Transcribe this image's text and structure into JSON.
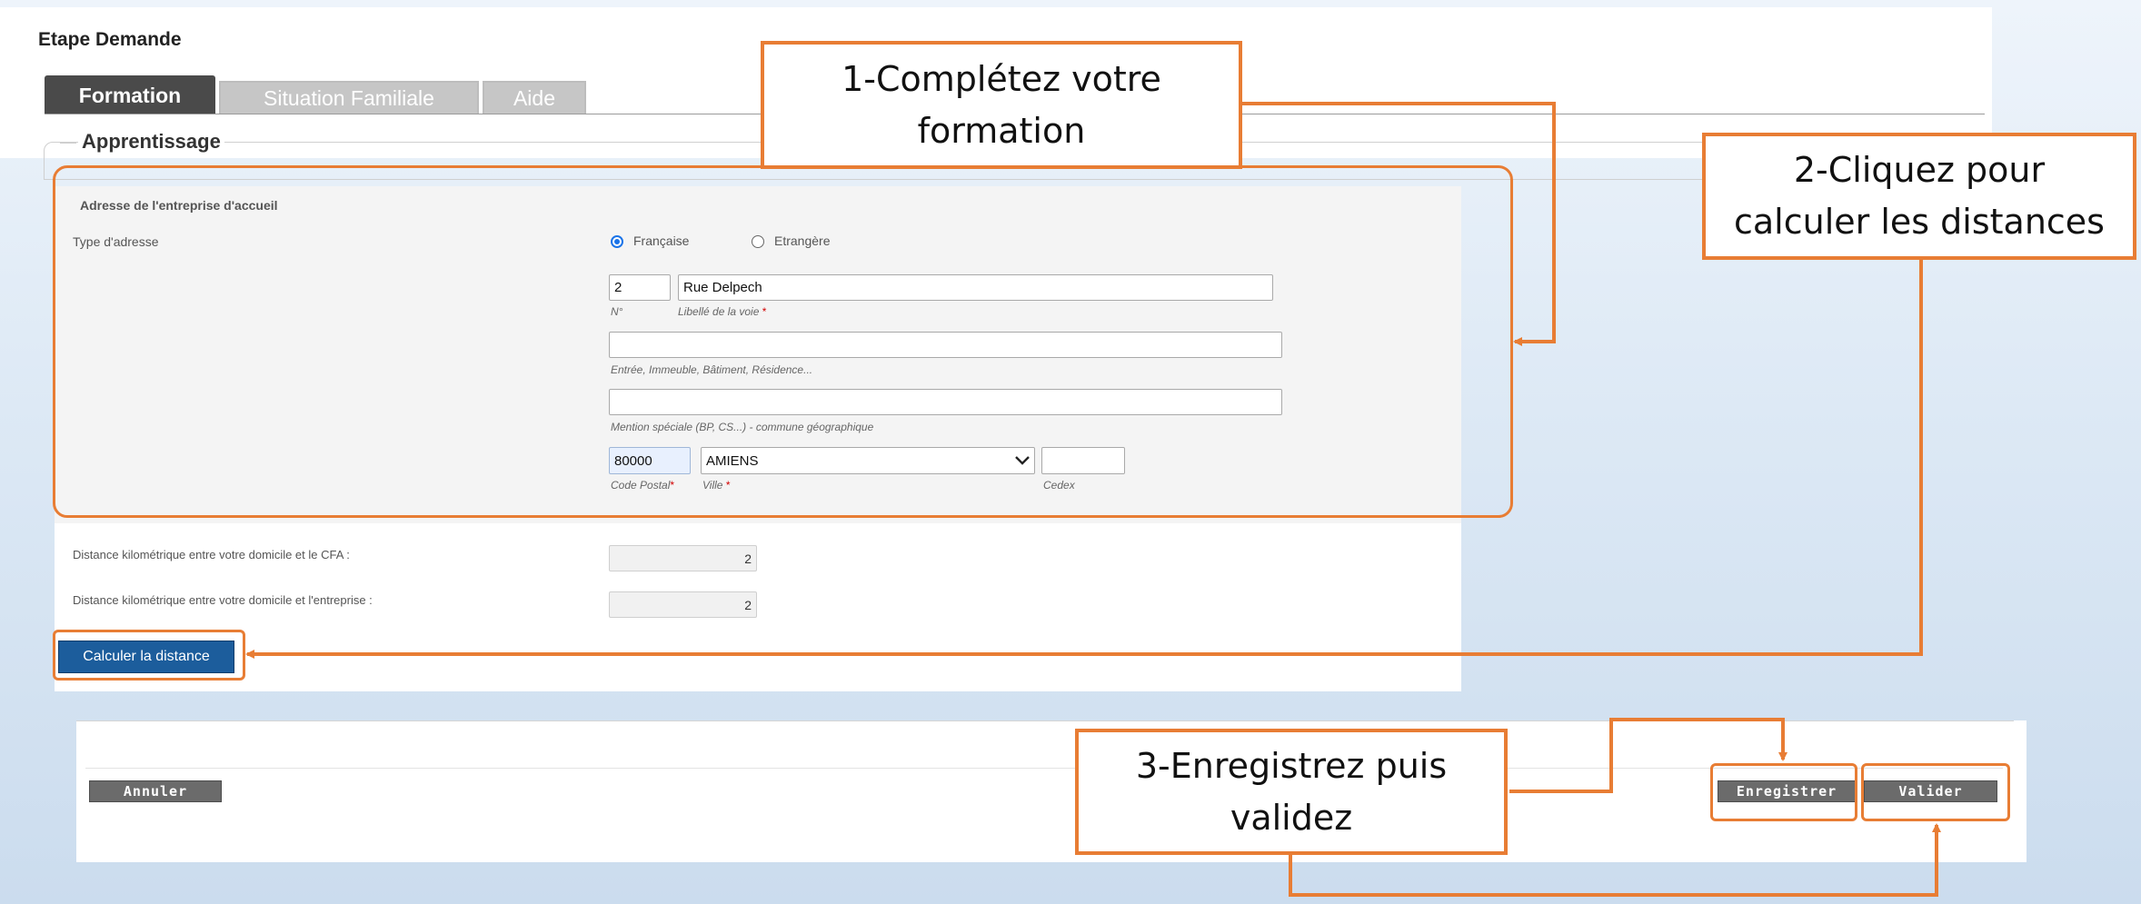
{
  "page": {
    "step_title": "Etape Demande"
  },
  "tabs": [
    {
      "label": "Formation",
      "active": true
    },
    {
      "label": "Situation Familiale",
      "active": false
    },
    {
      "label": "Aide",
      "active": false
    }
  ],
  "section": {
    "legend": "Apprentissage"
  },
  "address": {
    "title": "Adresse de l'entreprise d'accueil",
    "type_label": "Type d'adresse",
    "options": [
      {
        "label": "Française",
        "checked": true
      },
      {
        "label": "Etrangère",
        "checked": false
      }
    ],
    "number": {
      "value": "2",
      "help": "N°"
    },
    "street": {
      "value": "Rue Delpech",
      "help": "Libellé de la voie"
    },
    "line2": {
      "value": "",
      "help": "Entrée, Immeuble, Bâtiment, Résidence..."
    },
    "line3": {
      "value": "",
      "help": "Mention spéciale (BP, CS...) - commune géographique"
    },
    "postal": {
      "value": "80000",
      "help": "Code Postal"
    },
    "city": {
      "value": "AMIENS",
      "help": "Ville"
    },
    "cedex": {
      "value": "",
      "help": "Cedex"
    },
    "required_mark": "*"
  },
  "distances": [
    {
      "label": "Distance kilométrique entre votre domicile et le CFA :",
      "value": "2"
    },
    {
      "label": "Distance kilométrique entre votre domicile et l'entreprise :",
      "value": "2"
    }
  ],
  "calc_button": "Calculer la distance",
  "bottom": {
    "cancel": "Annuler",
    "save": "Enregistrer",
    "validate": "Valider"
  },
  "callouts": {
    "step1": {
      "line1": "1-Complétez votre",
      "line2": "formation"
    },
    "step2": {
      "line1": "2-Cliquez pour",
      "line2": "calculer les distances"
    },
    "step3": {
      "line1": "3-Enregistrez puis",
      "line2": "validez"
    }
  },
  "colors": {
    "accent": "#e87d34",
    "primary_button": "#1c5d9c",
    "radio": "#1a73e8",
    "gray_button": "#6b6b6b"
  },
  "icons": {
    "dropdown": "chevron-down-icon"
  }
}
